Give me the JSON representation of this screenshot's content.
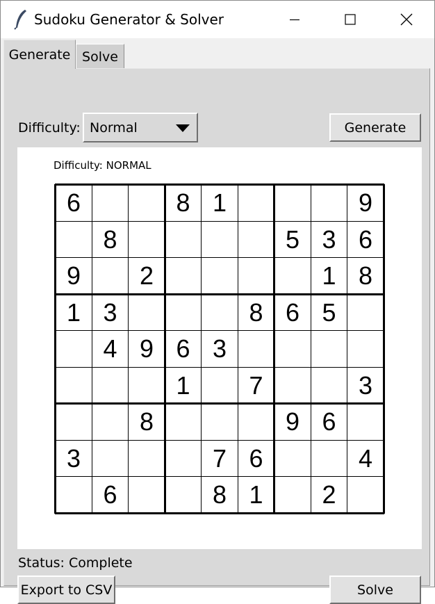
{
  "window": {
    "title": "Sudoku Generator & Solver"
  },
  "tabs": [
    {
      "label": "Generate",
      "active": true
    },
    {
      "label": "Solve",
      "active": false
    }
  ],
  "controls": {
    "difficulty_label": "Difficulty:",
    "difficulty_value": "Normal",
    "generate_label": "Generate"
  },
  "canvas": {
    "difficulty_text": "Difficulty: NORMAL"
  },
  "puzzle": [
    [
      6,
      0,
      0,
      8,
      1,
      0,
      0,
      0,
      9
    ],
    [
      0,
      8,
      0,
      0,
      0,
      0,
      5,
      3,
      6
    ],
    [
      9,
      0,
      2,
      0,
      0,
      0,
      0,
      1,
      8
    ],
    [
      1,
      3,
      0,
      0,
      0,
      8,
      6,
      5,
      0
    ],
    [
      0,
      4,
      9,
      6,
      3,
      0,
      0,
      0,
      0
    ],
    [
      0,
      0,
      0,
      1,
      0,
      7,
      0,
      0,
      3
    ],
    [
      0,
      0,
      8,
      0,
      0,
      0,
      9,
      6,
      0
    ],
    [
      3,
      0,
      0,
      0,
      7,
      6,
      0,
      0,
      4
    ],
    [
      0,
      6,
      0,
      0,
      8,
      1,
      0,
      2,
      0
    ]
  ],
  "footer": {
    "status": "Status: Complete",
    "export_label": "Export to CSV",
    "solve_label": "Solve"
  }
}
